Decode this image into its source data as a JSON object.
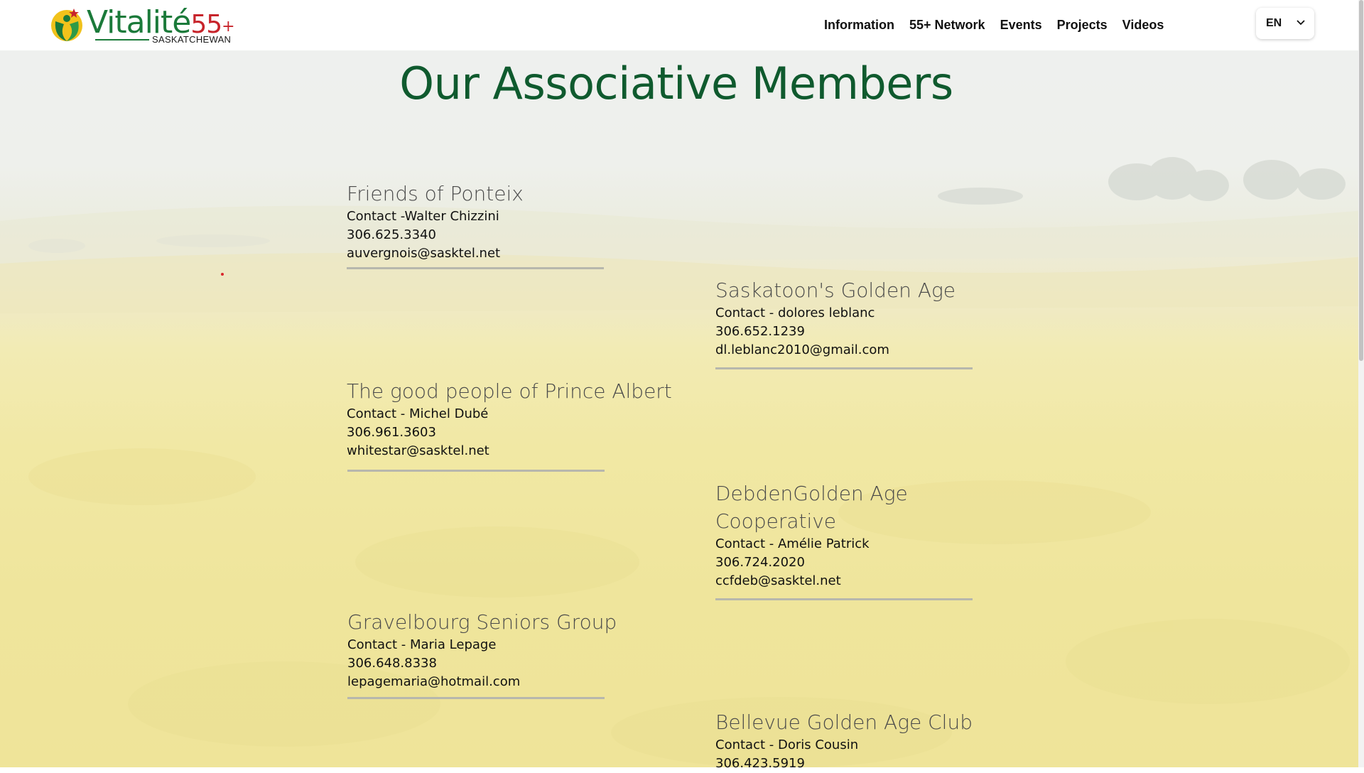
{
  "header": {
    "logo": {
      "word": "Vitalité",
      "number": "55",
      "plus": "+",
      "region": "SASKATCHEWAN"
    },
    "nav": [
      "Information",
      "55+ Network",
      "Events",
      "Projects",
      "Videos"
    ],
    "language": "EN"
  },
  "page": {
    "title": "Our Associative Members"
  },
  "members": [
    {
      "name": "Friends of Ponteix",
      "contact": "Contact -Walter Chizzini",
      "phone": "306.625.3340",
      "email": "auvergnois@sasktel.net"
    },
    {
      "name": "Saskatoon's Golden Age",
      "contact": "Contact - dolores leblanc",
      "phone": "306.652.1239",
      "email": "dl.leblanc2010@gmail.com"
    },
    {
      "name": "The good people of Prince Albert",
      "contact": "Contact - Michel Dubé",
      "phone": "306.961.3603",
      "email": "whitestar@sasktel.net"
    },
    {
      "name": "DebdenGolden Age Cooperative",
      "contact": "Contact - Amélie Patrick",
      "phone": "306.724.2020",
      "email": "ccfdeb@sasktel.net"
    },
    {
      "name": "Gravelbourg Seniors Group",
      "contact": "Contact - Maria Lepage",
      "phone": "306.648.8338",
      "email": "lepagemaria@hotmail.com"
    },
    {
      "name": "Bellevue Golden Age Club",
      "contact": "Contact - Doris Cousin",
      "phone": "306.423.5919",
      "email": ""
    }
  ],
  "colors": {
    "title_green": "#0f5a2e",
    "logo_green": "#1b7a3a",
    "logo_red": "#c7242b",
    "canola_yellow": "#efe59c"
  },
  "icons": {
    "logo_mark": "vitalite-person-icon",
    "language_chevron": "chevron-down-icon"
  }
}
